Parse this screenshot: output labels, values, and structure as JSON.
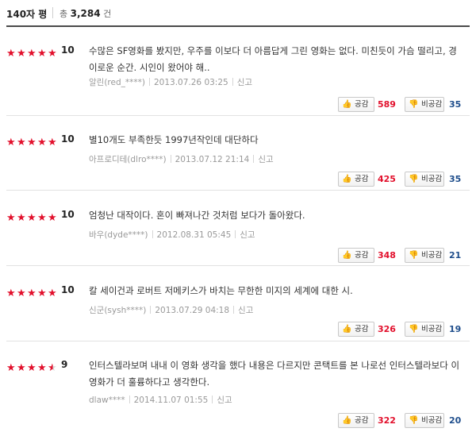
{
  "header": {
    "title": "140자 평",
    "total_prefix": "총",
    "total_count": "3,284",
    "total_suffix": "건"
  },
  "labels": {
    "like": "공감",
    "dislike": "비공감",
    "report": "신고"
  },
  "reviews": [
    {
      "stars": 5,
      "score": "10",
      "comment": "수많은 SF영화를 봤지만, 우주를 이보다 더 아름답게 그린 영화는 없다. 미친듯이 가슴 떨리고, 경이로운 순간. 시인이 왔어야 해..",
      "user": "알린(red_****)",
      "date": "2013.07.26 03:25",
      "likes": "589",
      "dislikes": "35"
    },
    {
      "stars": 5,
      "score": "10",
      "comment": "별10개도 부족한듯 1997년작인데 대단하다",
      "user": "아프로디테(dlro****)",
      "date": "2013.07.12 21:14",
      "likes": "425",
      "dislikes": "35"
    },
    {
      "stars": 5,
      "score": "10",
      "comment": "엄청난 대작이다. 혼이 빠져나간 것처럼 보다가 돌아왔다.",
      "user": "바우(dyde****)",
      "date": "2012.08.31 05:45",
      "likes": "348",
      "dislikes": "21"
    },
    {
      "stars": 5,
      "score": "10",
      "comment": "칼 세이건과 로버트 저메키스가 바치는 무한한 미지의 세계에 대한 시.",
      "user": "신군(sysh****)",
      "date": "2013.07.29 04:18",
      "likes": "326",
      "dislikes": "19"
    },
    {
      "stars": 4.5,
      "score": "9",
      "comment": "인터스텔라보며 내내 이 영화 생각을 했다 내용은 다르지만 콘택트를 본 나로선 인터스텔라보다 이 영화가 더 훌륭하다고 생각한다.",
      "user": "dlaw****",
      "date": "2014.11.07 01:55",
      "likes": "322",
      "dislikes": "20"
    }
  ]
}
